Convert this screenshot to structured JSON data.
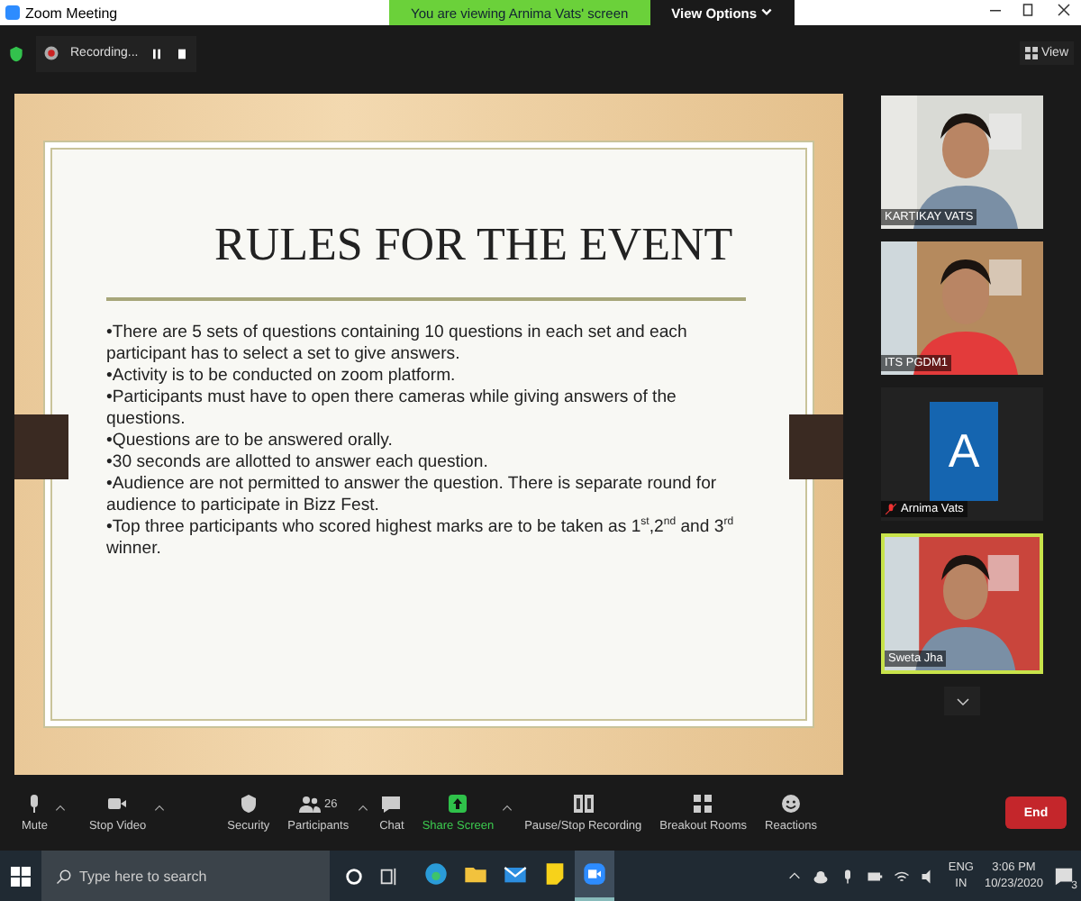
{
  "window": {
    "title": "Zoom Meeting"
  },
  "banner": {
    "text": "You are viewing Arnima Vats' screen",
    "options": "View Options"
  },
  "recording": {
    "label": "Recording..."
  },
  "view_button": "View",
  "slide": {
    "title": "RULES FOR THE EVENT",
    "bullets": [
      "•There are 5 sets of questions containing 10 questions in each set and each participant has to select a set to give answers.",
      "•Activity is to be conducted on zoom platform.",
      "•Participants must have to open there cameras while giving answers of the questions.",
      "•Questions are to be answered orally.",
      "•30 seconds are allotted to answer each question.",
      "•Audience are not permitted to answer the question. There is separate round for audience to participate in Bizz Fest.",
      "•Top three participants who scored highest marks are to be taken as 1$^{st}$,2$^{nd}$ and 3$^{rd}$ winner."
    ]
  },
  "participants": [
    {
      "kind": "video",
      "name": "KARTIKAY VATS",
      "active": false,
      "muted": false
    },
    {
      "kind": "video",
      "name": "ITS PGDM1",
      "active": false,
      "muted": false
    },
    {
      "kind": "avatar",
      "letter": "A",
      "name": "Arnima Vats",
      "active": false,
      "muted": true
    },
    {
      "kind": "video",
      "name": "Sweta Jha",
      "active": true,
      "muted": false
    }
  ],
  "toolbar": [
    {
      "kind": "mute",
      "label": "Mute",
      "caret": true
    },
    {
      "kind": "video",
      "label": "Stop Video",
      "caret": true
    },
    {
      "kind": "security",
      "label": "Security",
      "caret": false
    },
    {
      "kind": "participants",
      "label": "Participants",
      "count": "26",
      "caret": true
    },
    {
      "kind": "chat",
      "label": "Chat",
      "caret": false
    },
    {
      "kind": "share",
      "label": "Share Screen",
      "caret": true
    },
    {
      "kind": "record",
      "label": "Pause/Stop Recording",
      "caret": false
    },
    {
      "kind": "rooms",
      "label": "Breakout Rooms",
      "caret": false
    },
    {
      "kind": "reactions",
      "label": "Reactions",
      "caret": false
    }
  ],
  "end_button": "End",
  "taskbar": {
    "search_placeholder": "Type here to search",
    "apps": [
      {
        "kind": "edge",
        "selected": false
      },
      {
        "kind": "folder",
        "selected": false
      },
      {
        "kind": "mail",
        "selected": false
      },
      {
        "kind": "notes",
        "selected": false
      },
      {
        "kind": "zoom",
        "selected": true
      }
    ],
    "language": "ENG",
    "region": "IN",
    "time": "3:06 PM",
    "date": "10/23/2020",
    "notifications": "3"
  }
}
